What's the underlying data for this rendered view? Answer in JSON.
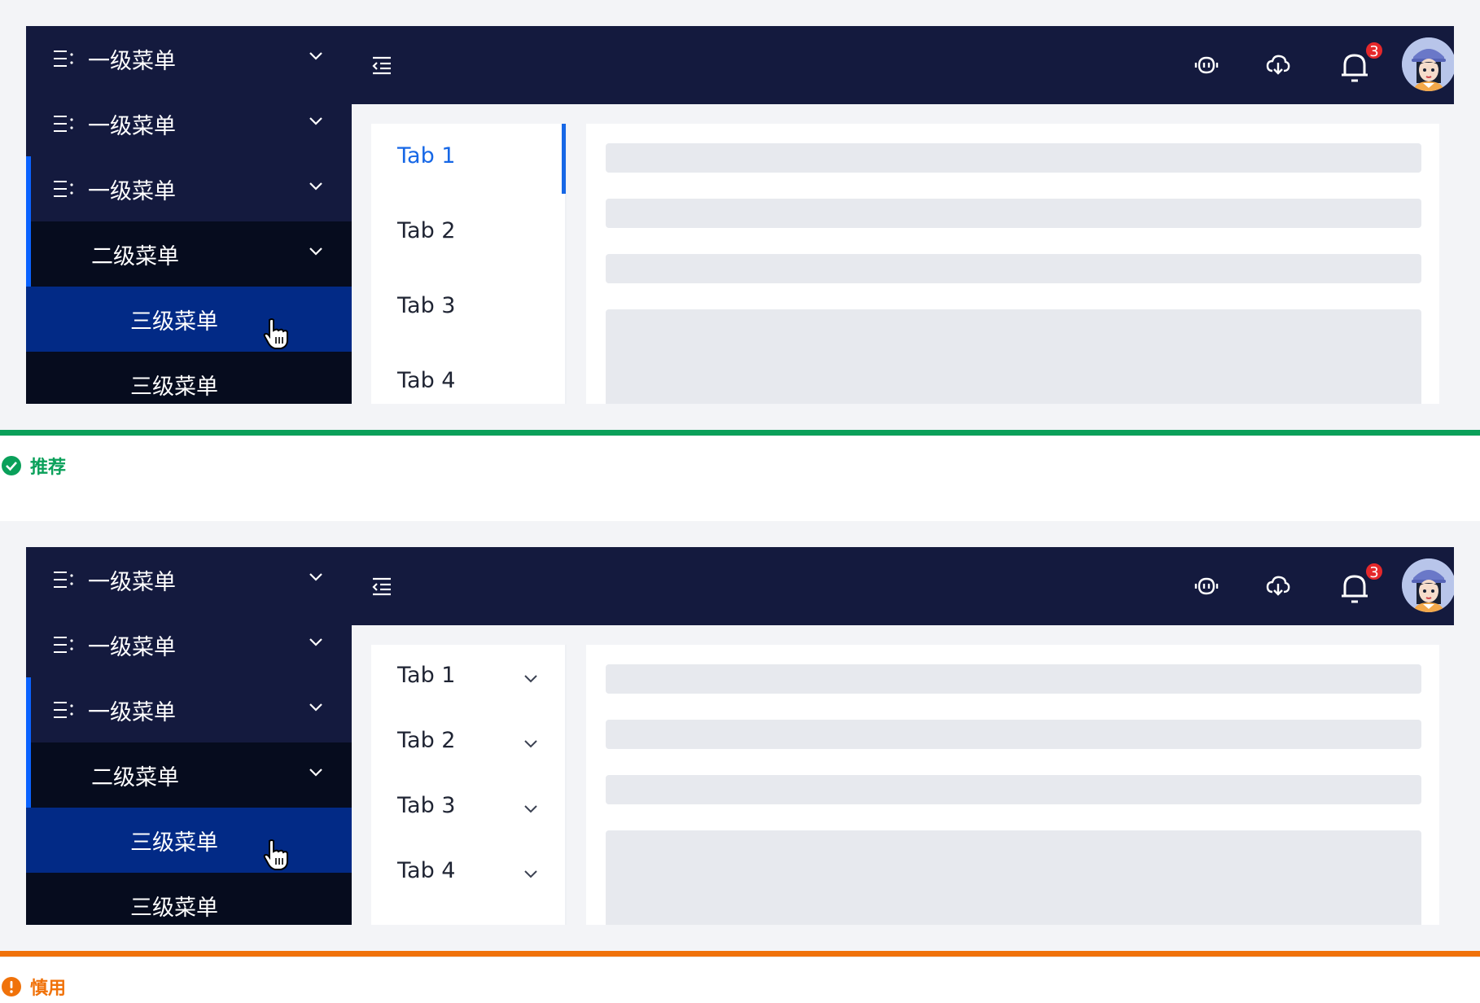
{
  "examples": [
    {
      "sidebar": {
        "items": [
          {
            "label": "一级菜单",
            "level": 1
          },
          {
            "label": "一级菜单",
            "level": 1
          },
          {
            "label": "一级菜单",
            "level": 1
          },
          {
            "label": "二级菜单",
            "level": 2
          },
          {
            "label": "三级菜单",
            "level": 3,
            "state": "hover"
          },
          {
            "label": "三级菜单",
            "level": 3
          }
        ]
      },
      "header": {
        "notification_count": "3"
      },
      "tabs": [
        {
          "label": "Tab 1",
          "active": true
        },
        {
          "label": "Tab 2"
        },
        {
          "label": "Tab 3"
        },
        {
          "label": "Tab 4"
        }
      ],
      "verdict": {
        "label": "推荐",
        "type": "recommended",
        "color": "#0aa05a",
        "icon": "check-circle-icon"
      }
    },
    {
      "sidebar": {
        "items": [
          {
            "label": "一级菜单",
            "level": 1
          },
          {
            "label": "一级菜单",
            "level": 1
          },
          {
            "label": "一级菜单",
            "level": 1
          },
          {
            "label": "二级菜单",
            "level": 2
          },
          {
            "label": "三级菜单",
            "level": 3,
            "state": "hover"
          },
          {
            "label": "三级菜单",
            "level": 3
          }
        ]
      },
      "header": {
        "notification_count": "3"
      },
      "tabs": [
        {
          "label": "Tab 1",
          "expandable": true
        },
        {
          "label": "Tab 2",
          "expandable": true
        },
        {
          "label": "Tab 3",
          "expandable": true
        },
        {
          "label": "Tab 4",
          "expandable": true
        }
      ],
      "verdict": {
        "label": "慎用",
        "type": "caution",
        "color": "#f0720a",
        "icon": "exclamation-circle-icon"
      }
    }
  ],
  "colors": {
    "nav_bg": "#141a3e",
    "submenu_bg": "#060c1e",
    "hover_bg": "#022a86",
    "accent": "#1667e6",
    "badge": "#e5282b"
  }
}
